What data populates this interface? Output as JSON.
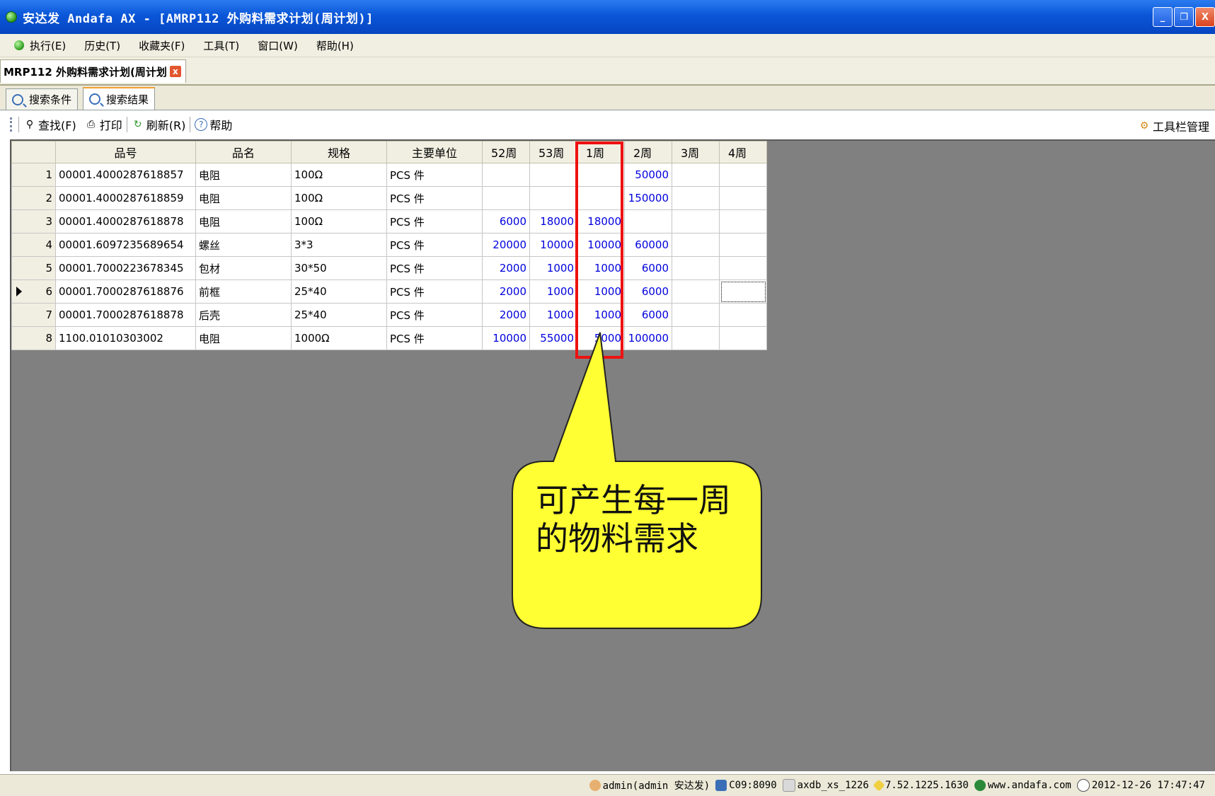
{
  "window": {
    "title": "安达发 Andafa AX - [AMRP112 外购料需求计划(周计划)]",
    "buttons": {
      "minimize": "_",
      "restore": "❐",
      "close": "X"
    }
  },
  "menu": [
    "执行(E)",
    "历史(T)",
    "收藏夹(F)",
    "工具(T)",
    "窗口(W)",
    "帮助(H)"
  ],
  "doc_tab": {
    "label": "MRP112 外购料需求计划(周计划",
    "close": "x"
  },
  "sub_tabs": [
    {
      "label": "搜索条件",
      "active": false
    },
    {
      "label": "搜索结果",
      "active": true
    }
  ],
  "toolbar": {
    "find": "查找(F)",
    "print": "打印",
    "refresh": "刷新(R)",
    "help": "帮助",
    "manage": "工具栏管理"
  },
  "grid": {
    "columns": [
      "品号",
      "品名",
      "规格",
      "主要单位",
      "52周",
      "53周",
      "1周",
      "2周",
      "3周",
      "4周"
    ],
    "rows": [
      {
        "n": "1",
        "code": "00001.4000287618857",
        "name": "电阻",
        "spec": "100Ω",
        "unit": "PCS 件",
        "w": [
          "",
          "",
          "",
          "50000",
          "",
          ""
        ]
      },
      {
        "n": "2",
        "code": "00001.4000287618859",
        "name": "电阻",
        "spec": "100Ω",
        "unit": "PCS 件",
        "w": [
          "",
          "",
          "",
          "150000",
          "",
          ""
        ]
      },
      {
        "n": "3",
        "code": "00001.4000287618878",
        "name": "电阻",
        "spec": "100Ω",
        "unit": "PCS 件",
        "w": [
          "6000",
          "18000",
          "18000",
          "",
          "",
          ""
        ]
      },
      {
        "n": "4",
        "code": "00001.6097235689654",
        "name": "螺丝",
        "spec": "3*3",
        "unit": "PCS 件",
        "w": [
          "20000",
          "10000",
          "10000",
          "60000",
          "",
          ""
        ]
      },
      {
        "n": "5",
        "code": "00001.7000223678345",
        "name": "包材",
        "spec": "30*50",
        "unit": "PCS 件",
        "w": [
          "2000",
          "1000",
          "1000",
          "6000",
          "",
          ""
        ]
      },
      {
        "n": "6",
        "code": "00001.7000287618876",
        "name": "前框",
        "spec": "25*40",
        "unit": "PCS 件",
        "w": [
          "2000",
          "1000",
          "1000",
          "6000",
          "",
          ""
        ]
      },
      {
        "n": "7",
        "code": "00001.7000287618878",
        "name": "后壳",
        "spec": "25*40",
        "unit": "PCS 件",
        "w": [
          "2000",
          "1000",
          "1000",
          "6000",
          "",
          ""
        ]
      },
      {
        "n": "8",
        "code": "1100.01010303002",
        "name": "电阻",
        "spec": "1000Ω",
        "unit": "PCS 件",
        "w": [
          "10000",
          "55000",
          "5000",
          "100000",
          "",
          ""
        ]
      }
    ],
    "current_row": 6
  },
  "callout": {
    "line1": "可产生每一周",
    "line2": "的物料需求",
    "fill": "#ffff33",
    "border": "#222222"
  },
  "highlight_color": "#ee1111",
  "status": {
    "user": "admin(admin 安达发)",
    "server": "C09:8090",
    "database": "axdb_xs_1226",
    "version": "7.52.1225.1630",
    "website": "www.andafa.com",
    "datetime": "2012-12-26 17:47:47"
  }
}
